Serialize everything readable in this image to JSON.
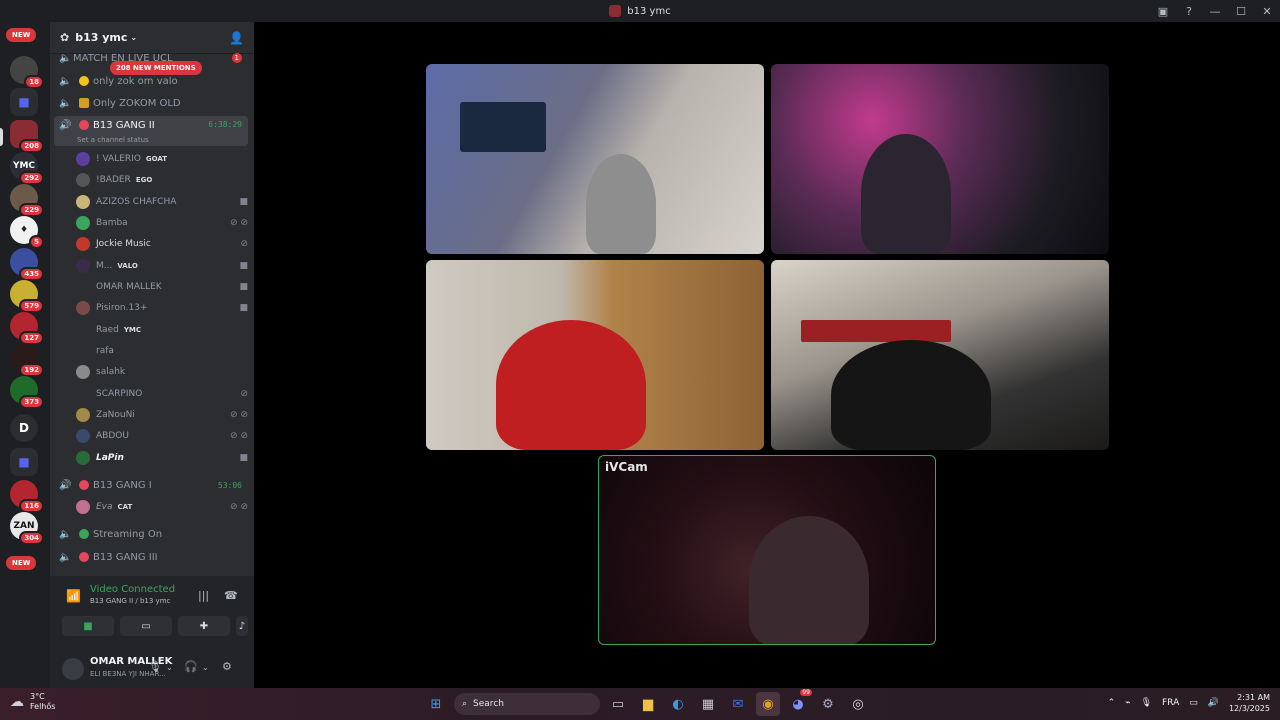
{
  "window": {
    "title": "b13 ymc"
  },
  "rail": {
    "new_top": "NEW",
    "new_bottom": "NEW",
    "servers": [
      {
        "badge": "18"
      },
      {
        "badge": ""
      },
      {
        "badge": "208"
      },
      {
        "badge": "292"
      },
      {
        "badge": "229"
      },
      {
        "badge": "5"
      },
      {
        "badge": "435"
      },
      {
        "badge": "579"
      },
      {
        "badge": "127"
      },
      {
        "badge": "192"
      },
      {
        "badge": "373"
      },
      {
        "badge": ""
      },
      {
        "badge": ""
      },
      {
        "badge": "116"
      },
      {
        "badge": "304"
      }
    ],
    "letter_server": "D"
  },
  "channel_list": {
    "server_name": "b13 ymc",
    "new_mentions": "208 NEW MENTIONS",
    "channels": [
      {
        "name": "MATCH EN LIVE UCL",
        "count": "1"
      },
      {
        "name": "only zok om valo"
      },
      {
        "name": "Only ZOKOM OLD"
      },
      {
        "name": "B13 GANG II",
        "time": "6:38:29",
        "sub": "Set a channel status"
      },
      {
        "name": "B13 GANG I",
        "time": "53:06"
      },
      {
        "name": "Streaming On"
      },
      {
        "name": "B13 GANG III"
      }
    ],
    "users": [
      {
        "name": "! VALERIO",
        "tag": "GOAT"
      },
      {
        "name": "!BADER",
        "tag": "EGO"
      },
      {
        "name": "AZIZOS CHAFCHA",
        "tag": ""
      },
      {
        "name": "Bamba",
        "tag": ""
      },
      {
        "name": "Jockie Music",
        "tag": ""
      },
      {
        "name": "M...",
        "tag": "VALO"
      },
      {
        "name": "OMAR MALLEK",
        "tag": ""
      },
      {
        "name": "Pisiron.13+",
        "tag": ""
      },
      {
        "name": "Raed",
        "tag": "YMC"
      },
      {
        "name": "rafa",
        "tag": ""
      },
      {
        "name": "salahk",
        "tag": ""
      },
      {
        "name": "SCARPINO",
        "tag": ""
      },
      {
        "name": "ZaNouNi",
        "tag": ""
      },
      {
        "name": "ABDOU",
        "tag": ""
      },
      {
        "name": "LaPin",
        "tag": ""
      }
    ],
    "gang1_user": {
      "name": "Eva",
      "tag": "CAT"
    }
  },
  "voice": {
    "status": "Video Connected",
    "location": "B13 GANG II / b13 ymc"
  },
  "me": {
    "name": "OMAR MALLEK",
    "status": "ELI BE3NA YJI NHAR..."
  },
  "stage": {
    "ivcam_label": "iVCam"
  },
  "taskbar": {
    "temp": "3°C",
    "place": "Felhős",
    "search": "Search",
    "lang": "FRA",
    "time": "2:31 AM",
    "date": "12/3/2025",
    "discord_badge": "99"
  }
}
